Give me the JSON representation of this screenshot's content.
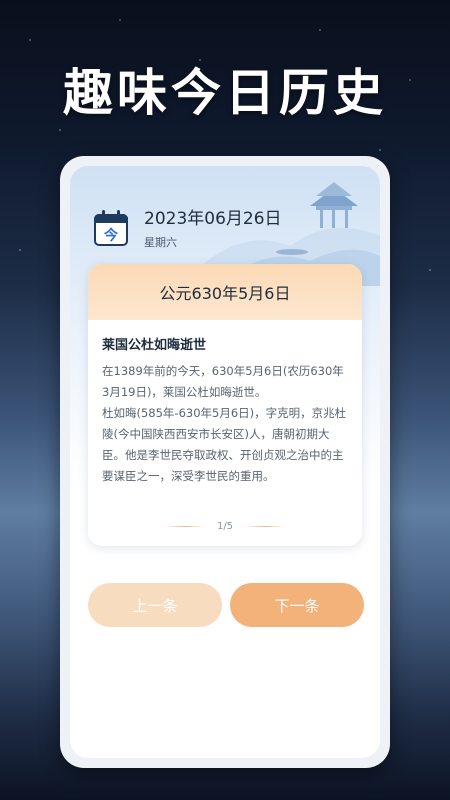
{
  "headline": "趣味今日历史",
  "calendar_icon_char": "今",
  "date": {
    "main": "2023年06月26日",
    "weekday": "星期六"
  },
  "card": {
    "header_date": "公元630年5月6日",
    "title": "莱国公杜如晦逝世",
    "paragraphs": [
      "在1389年前的今天，630年5月6日(农历630年3月19日)，莱国公杜如晦逝世。",
      "杜如晦(585年-630年5月6日)，字克明，京兆杜陵(今中国陕西西安市长安区)人，唐朝初期大臣。他是李世民夺取政权、开创贞观之治中的主要谋臣之一，深受李世民的重用。"
    ],
    "pager": "1/5"
  },
  "buttons": {
    "prev": "上一条",
    "next": "下一条"
  },
  "colors": {
    "accent": "#f3b27a",
    "accent_light": "#f8dcc0",
    "card_header": "#fbd9b6",
    "icon_blue": "#1e3a5f"
  }
}
